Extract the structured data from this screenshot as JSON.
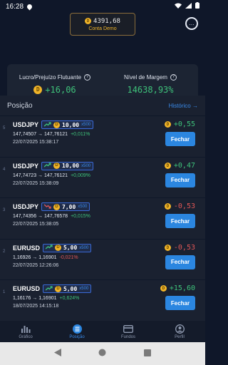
{
  "status_bar": {
    "time": "16:28"
  },
  "header": {
    "balance": "4391,68",
    "account_label": "Conta Demo"
  },
  "summary": {
    "floating_label": "Lucro/Prejuízo Flutuante",
    "floating_value": "+16,06",
    "margin_label": "Nível de Margem",
    "margin_value": "14638,93%"
  },
  "positions": {
    "title": "Posição",
    "history_label": "Histórico",
    "close_label": "Fechar",
    "rows": [
      {
        "num": "5",
        "symbol": "USDJPY",
        "direction": "up",
        "amount": "10,00",
        "leverage": "x500",
        "open": "147,74507",
        "current": "147,76121",
        "change": "+0,011%",
        "change_dir": "up",
        "date": "22/07/2025 15:38:17",
        "pnl": "+0,55",
        "pnl_dir": "up"
      },
      {
        "num": "4",
        "symbol": "USDJPY",
        "direction": "up",
        "amount": "10,00",
        "leverage": "x500",
        "open": "147,74723",
        "current": "147,76121",
        "change": "+0,009%",
        "change_dir": "up",
        "date": "22/07/2025 15:38:09",
        "pnl": "+0,47",
        "pnl_dir": "up"
      },
      {
        "num": "3",
        "symbol": "USDJPY",
        "direction": "down",
        "amount": "7,00",
        "leverage": "x500",
        "open": "147,74356",
        "current": "147,76578",
        "change": "+0,015%",
        "change_dir": "up",
        "date": "22/07/2025 15:38:05",
        "pnl": "-0,53",
        "pnl_dir": "down"
      },
      {
        "num": "2",
        "symbol": "EURUSD",
        "direction": "up",
        "amount": "5,00",
        "leverage": "x500",
        "open": "1,16926",
        "current": "1,16901",
        "change": "-0,021%",
        "change_dir": "down",
        "date": "22/07/2025 12:26:06",
        "pnl": "-0,53",
        "pnl_dir": "down"
      },
      {
        "num": "1",
        "symbol": "EURUSD",
        "direction": "up",
        "amount": "5,00",
        "leverage": "x500",
        "open": "1,16176",
        "current": "1,16901",
        "change": "+0,624%",
        "change_dir": "up",
        "date": "18/07/2025 14:15:18",
        "pnl": "+15,60",
        "pnl_dir": "up"
      }
    ]
  },
  "nav": {
    "items": [
      {
        "label": "Gráfico",
        "icon": "chart-icon"
      },
      {
        "label": "Posição",
        "icon": "list-icon"
      },
      {
        "label": "Fundos",
        "icon": "wallet-icon"
      },
      {
        "label": "Perfil",
        "icon": "profile-icon"
      }
    ],
    "active": "Posição"
  },
  "colors": {
    "accent": "#2b86e0",
    "gain": "#3ec27a",
    "loss": "#e05656",
    "coin": "#f0b429"
  }
}
